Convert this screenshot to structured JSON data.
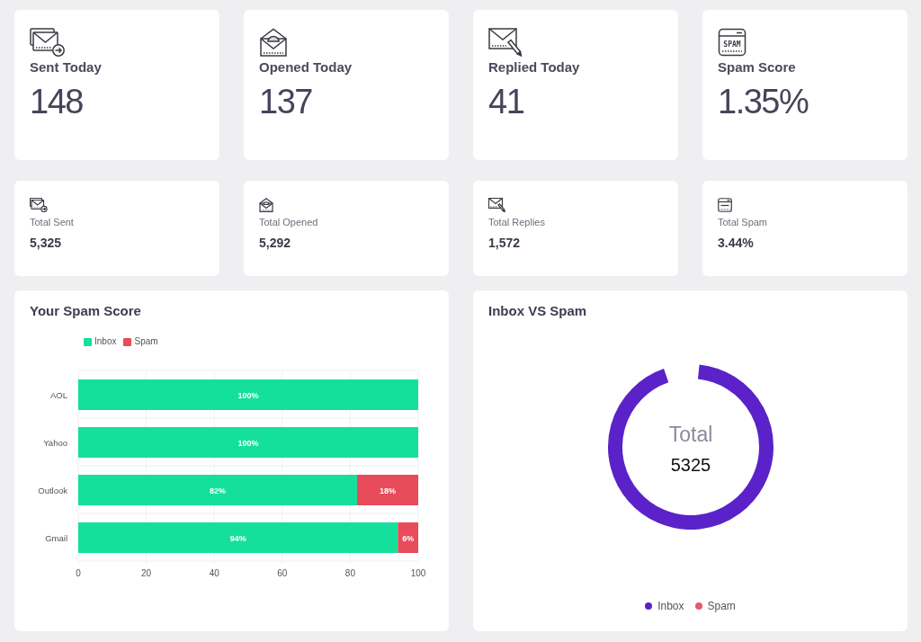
{
  "today_cards": [
    {
      "kind": "sent",
      "label": "Sent Today",
      "value": "148"
    },
    {
      "kind": "opened",
      "label": "Opened Today",
      "value": "137"
    },
    {
      "kind": "replied",
      "label": "Replied Today",
      "value": "41"
    },
    {
      "kind": "spam",
      "label": "Spam Score",
      "value": "1.35%",
      "icon_text": "SPAM"
    }
  ],
  "total_cards": [
    {
      "kind": "sent",
      "label": "Total Sent",
      "value": "5,325"
    },
    {
      "kind": "opened",
      "label": "Total Opened",
      "value": "5,292"
    },
    {
      "kind": "replied",
      "label": "Total Replies",
      "value": "1,572"
    },
    {
      "kind": "spam",
      "label": "Total Spam",
      "value": "3.44%"
    }
  ],
  "spam_score_panel": {
    "title": "Your Spam Score",
    "chart_data": {
      "type": "bar",
      "orientation": "horizontal",
      "stacked": true,
      "grid": true,
      "legend": true,
      "categories": [
        "AOL",
        "Yahoo",
        "Outlook",
        "Gmail"
      ],
      "series": [
        {
          "name": "Inbox",
          "color": "#14e09c",
          "values": [
            100,
            100,
            82,
            94
          ]
        },
        {
          "name": "Spam",
          "color": "#e84b5a",
          "values": [
            0,
            0,
            18,
            6
          ]
        }
      ],
      "xlim": [
        0,
        100
      ],
      "xticks": [
        0,
        20,
        40,
        60,
        80,
        100
      ],
      "value_labels": [
        [
          "100%",
          "100%",
          "82%",
          "94%"
        ],
        [
          "18%",
          "6%"
        ]
      ]
    }
  },
  "inbox_vs_spam_panel": {
    "title": "Inbox VS Spam",
    "center_label": "Total",
    "center_value": "5325",
    "legend": [
      {
        "label": "Inbox",
        "color": "#5a22c8"
      },
      {
        "label": "Spam",
        "color": "#e25c69"
      }
    ]
  }
}
